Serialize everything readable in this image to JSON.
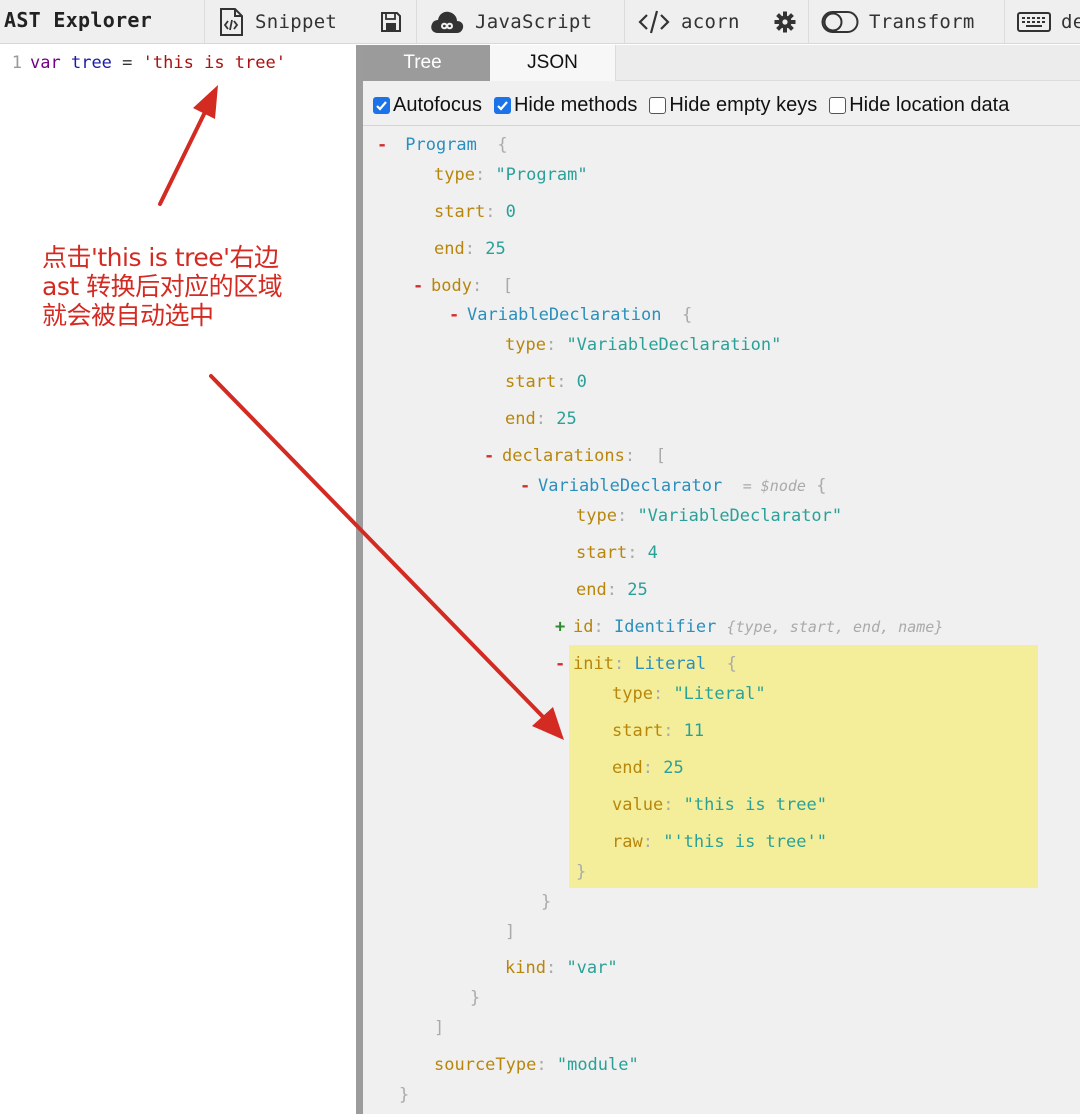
{
  "toolbar": {
    "title": "AST Explorer",
    "snippet_label": "Snippet",
    "language_label": "JavaScript",
    "parser_label": "acorn",
    "transform_label": "Transform",
    "keymap_label": "de"
  },
  "editor": {
    "line_number": "1",
    "code": {
      "keyword": "var",
      "identifier": "tree",
      "operator": "=",
      "string": "'this is tree'"
    }
  },
  "annotation": {
    "lines": [
      "点击'this is tree'右边",
      "ast 转换后对应的区域",
      "就会被自动选中"
    ],
    "color": "#d32a22"
  },
  "output": {
    "tabs": {
      "active": "Tree",
      "inactive": "JSON"
    },
    "options": [
      {
        "label": "Autofocus",
        "checked": true
      },
      {
        "label": "Hide methods",
        "checked": true
      },
      {
        "label": "Hide empty keys",
        "checked": false
      },
      {
        "label": "Hide location data",
        "checked": false
      }
    ]
  },
  "tree": {
    "program_name": "Program",
    "program_type": "\"Program\"",
    "program_start": "0",
    "program_end": "25",
    "body_key": "body",
    "vardecl_name": "VariableDeclaration",
    "vardecl_type": "\"VariableDeclaration\"",
    "vardecl_start": "0",
    "vardecl_end": "25",
    "declarations_key": "declarations",
    "declarator_name": "VariableDeclarator",
    "declarator_meta": "= $node",
    "declarator_type": "\"VariableDeclarator\"",
    "declarator_start": "4",
    "declarator_end": "25",
    "id_key": "id",
    "id_name": "Identifier",
    "id_summary": "{type, start, end, name}",
    "init_key": "init",
    "init_name": "Literal",
    "literal_type": "\"Literal\"",
    "literal_start": "11",
    "literal_end": "25",
    "literal_value": "\"this is tree\"",
    "literal_raw": "\"'this is tree'\"",
    "kind_value": "\"var\"",
    "source_type_value": "\"module\"",
    "keys": {
      "type": "type",
      "start": "start",
      "end": "end",
      "value": "value",
      "raw": "raw",
      "kind": "kind",
      "sourceType": "sourceType"
    },
    "highlight_color": "#f4ee9a"
  }
}
